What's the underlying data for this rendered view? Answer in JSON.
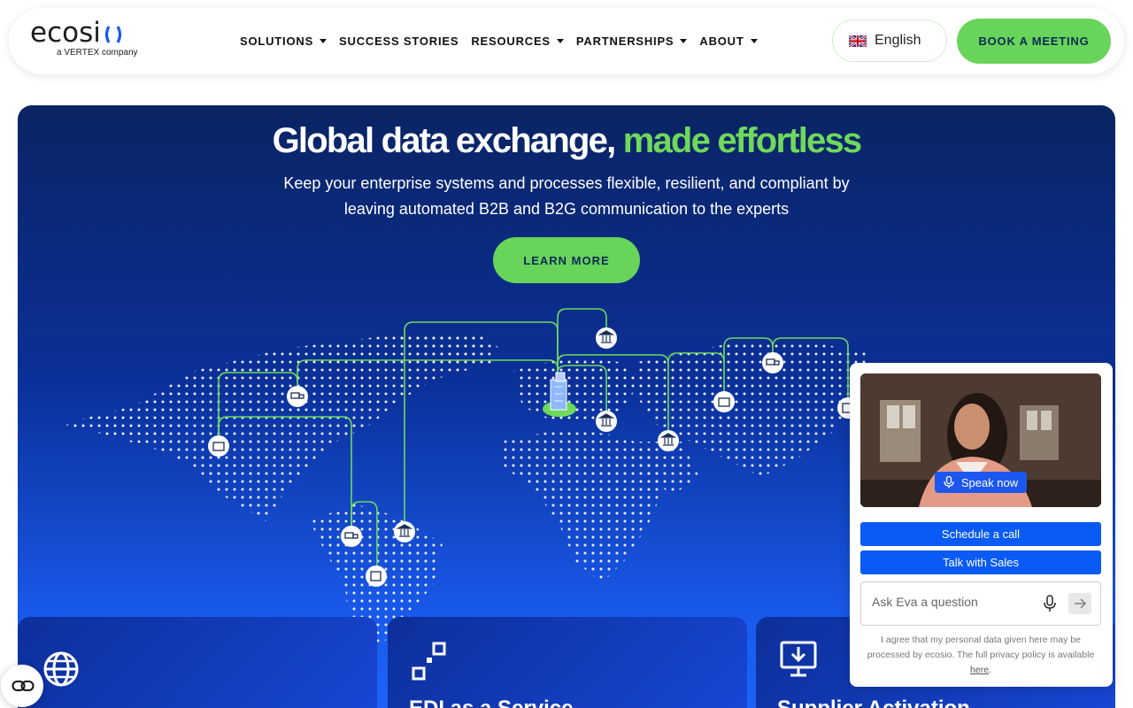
{
  "brand": {
    "logo_text": "ecosi",
    "logo_sub": "a VERTEX company"
  },
  "nav": {
    "items": [
      {
        "label": "SOLUTIONS",
        "has_caret": true
      },
      {
        "label": "SUCCESS STORIES",
        "has_caret": false
      },
      {
        "label": "RESOURCES",
        "has_caret": true
      },
      {
        "label": "PARTNERSHIPS",
        "has_caret": true
      },
      {
        "label": "ABOUT",
        "has_caret": true
      }
    ],
    "language": "English",
    "cta": "BOOK A MEETING"
  },
  "hero": {
    "title_main": "Global data exchange,",
    "title_accent": "made effortless",
    "subtitle": "Keep your enterprise systems and processes flexible, resilient, and compliant by leaving automated B2B and B2G communication to the experts",
    "cta": "LEARN MORE"
  },
  "cards": [
    {
      "title": "",
      "icon": "globe-icon"
    },
    {
      "title": "EDI as a Service",
      "icon": "squares-icon"
    },
    {
      "title": "Supplier Activation",
      "icon": "monitor-download-icon"
    }
  ],
  "chat": {
    "speak": "Speak now",
    "schedule": "Schedule a call",
    "sales": "Talk with Sales",
    "ask_placeholder": "Ask Eva a question",
    "consent": "I agree that my personal data given here may be processed by ecosio. The full privacy policy is available",
    "consent_link": "here"
  },
  "colors": {
    "accent_green": "#69d45a",
    "hero_dark": "#0a2463",
    "hero_light": "#1e62f7",
    "chat_blue": "#0a5af5"
  }
}
